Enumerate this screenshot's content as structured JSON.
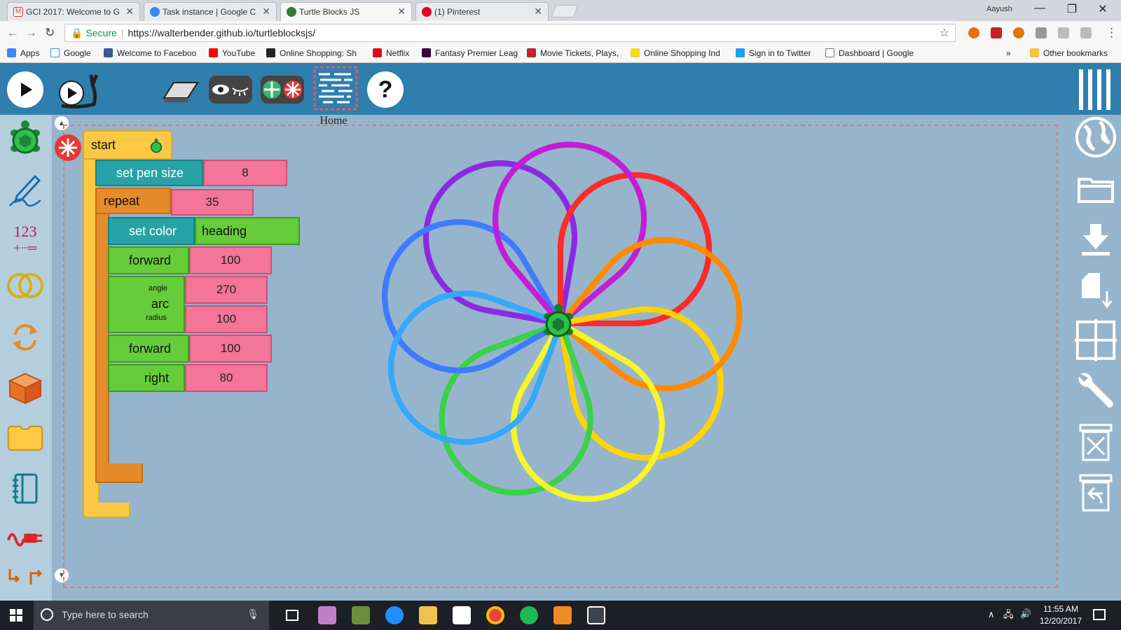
{
  "browser": {
    "tabs": [
      {
        "title": "GCI 2017: Welcome to G",
        "icon": "gmail-icon",
        "color": "#d93025"
      },
      {
        "title": "Task instance | Google C",
        "icon": "gci-icon",
        "color": "#4285f4"
      },
      {
        "title": "Turtle Blocks JS",
        "icon": "turtle-icon",
        "color": "#2e7d32"
      },
      {
        "title": "(1) Pinterest",
        "icon": "pinterest-icon",
        "color": "#e60023"
      }
    ],
    "user_name": "Aayush",
    "address": {
      "secure_label": "Secure",
      "url": "https://walterbender.github.io/turtleblocksjs/"
    },
    "bookmarks": [
      "Apps",
      "Google",
      "Welcome to Faceboo",
      "YouTube",
      "Online Shopping: Sh",
      "Netflix",
      "Fantasy Premier Leag",
      "Movie Tickets, Plays,",
      "Online Shopping Ind",
      "Sign in to Twitter",
      "Dashboard | Google",
      "Other bookmarks"
    ]
  },
  "app": {
    "home_label": "Home",
    "blocks": {
      "start": "start",
      "set_pen_size": {
        "label": "set pen size",
        "value": "8"
      },
      "repeat": {
        "label": "repeat",
        "value": "35"
      },
      "set_color": {
        "label": "set color",
        "value": "heading"
      },
      "forward1": {
        "label": "forward",
        "value": "100"
      },
      "arc": {
        "label": "arc",
        "angle_label": "angle",
        "radius_label": "radius",
        "angle": "270",
        "radius": "100"
      },
      "forward2": {
        "label": "forward",
        "value": "100"
      },
      "right": {
        "label": "right",
        "value": "80"
      }
    },
    "palette_number_label": "123",
    "drawing_colors": [
      "#ff2a2a",
      "#ff8a00",
      "#ffd400",
      "#f5f52a",
      "#3bd14a",
      "#18c9a0",
      "#35a8ff",
      "#3f7bff",
      "#8a2be2",
      "#c21ed6",
      "#ff1fa5"
    ]
  },
  "taskbar": {
    "search_placeholder": "Type here to search",
    "time": "11:55 AM",
    "date": "12/20/2017"
  }
}
